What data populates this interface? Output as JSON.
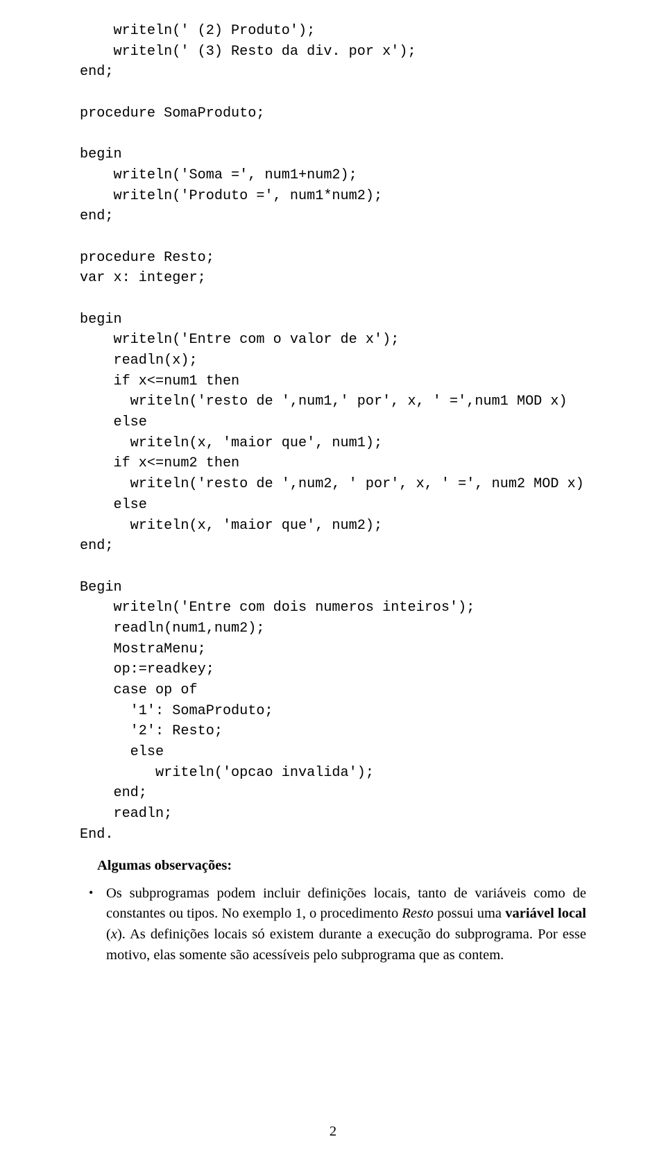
{
  "code": "    writeln(' (2) Produto');\n    writeln(' (3) Resto da div. por x');\nend;\n\nprocedure SomaProduto;\n\nbegin\n    writeln('Soma =', num1+num2);\n    writeln('Produto =', num1*num2);\nend;\n\nprocedure Resto;\nvar x: integer;\n\nbegin\n    writeln('Entre com o valor de x');\n    readln(x);\n    if x<=num1 then\n      writeln('resto de ',num1,' por', x, ' =',num1 MOD x)\n    else\n      writeln(x, 'maior que', num1);\n    if x<=num2 then\n      writeln('resto de ',num2, ' por', x, ' =', num2 MOD x)\n    else\n      writeln(x, 'maior que', num2);\nend;\n\nBegin\n    writeln('Entre com dois numeros inteiros');\n    readln(num1,num2);\n    MostraMenu;\n    op:=readkey;\n    case op of\n      '1': SomaProduto;\n      '2': Resto;\n      else\n         writeln('opcao invalida');\n    end;\n    readln;\nEnd.",
  "heading": "Algumas observações:",
  "bullet": {
    "t1": "Os subprogramas podem incluir definições locais, tanto de variáveis como de constantes ou tipos. No exemplo 1, o procedimento ",
    "i1": "Resto",
    "t2": " possui uma ",
    "b1": "variável local",
    "t3": " (",
    "i2": "x",
    "t4": "). As definições locais só existem durante a execução do subprograma. Por esse motivo, elas somente são acessíveis pelo subprograma que as contem."
  },
  "pageNumber": "2"
}
